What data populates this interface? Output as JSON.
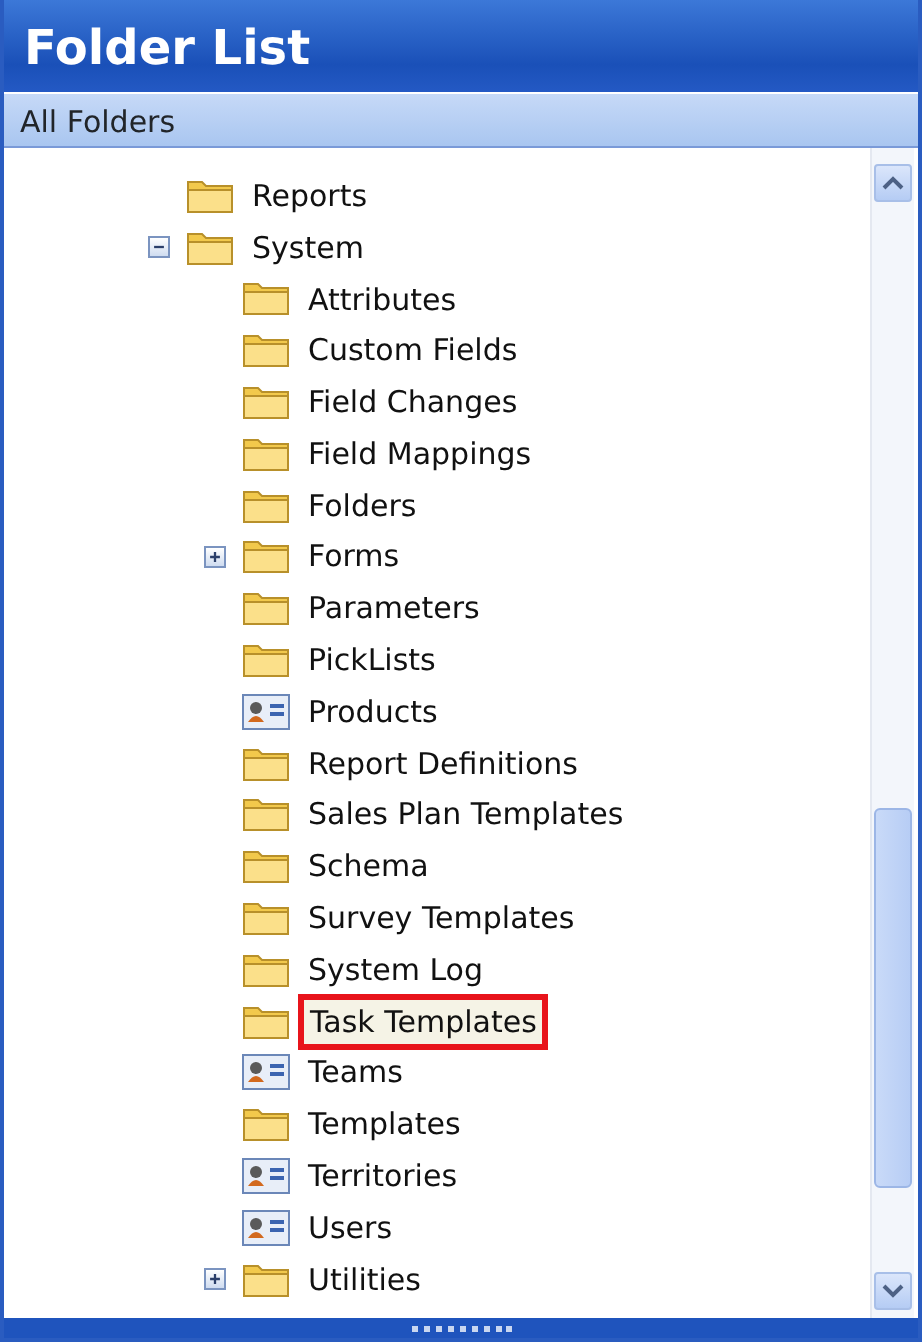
{
  "window": {
    "title": "Folder List"
  },
  "header": {
    "label": "All Folders"
  },
  "tree": [
    {
      "label": "Reports",
      "kind": "folder",
      "selected": false
    },
    {
      "label": "System",
      "kind": "folder",
      "selected": false,
      "expanded": true,
      "children": [
        {
          "label": "Attributes",
          "kind": "folder",
          "selected": false
        },
        {
          "label": "Custom Fields",
          "kind": "folder",
          "selected": false
        },
        {
          "label": "Field Changes",
          "kind": "folder",
          "selected": false
        },
        {
          "label": "Field Mappings",
          "kind": "folder",
          "selected": false
        },
        {
          "label": "Folders",
          "kind": "folder",
          "selected": false
        },
        {
          "label": "Forms",
          "kind": "folder",
          "selected": false,
          "expanded": false
        },
        {
          "label": "Parameters",
          "kind": "folder",
          "selected": false
        },
        {
          "label": "PickLists",
          "kind": "folder",
          "selected": false
        },
        {
          "label": "Products",
          "kind": "card",
          "selected": false
        },
        {
          "label": "Report Definitions",
          "kind": "folder",
          "selected": false
        },
        {
          "label": "Sales Plan Templates",
          "kind": "folder",
          "selected": false
        },
        {
          "label": "Schema",
          "kind": "folder",
          "selected": false
        },
        {
          "label": "Survey Templates",
          "kind": "folder",
          "selected": false
        },
        {
          "label": "System Log",
          "kind": "folder",
          "selected": false
        },
        {
          "label": "Task Templates",
          "kind": "folder",
          "selected": true
        },
        {
          "label": "Teams",
          "kind": "card",
          "selected": false
        },
        {
          "label": "Templates",
          "kind": "folder",
          "selected": false
        },
        {
          "label": "Territories",
          "kind": "card",
          "selected": false
        },
        {
          "label": "Users",
          "kind": "card",
          "selected": false
        },
        {
          "label": "Utilities",
          "kind": "folder",
          "selected": false,
          "expanded": false
        }
      ]
    }
  ]
}
